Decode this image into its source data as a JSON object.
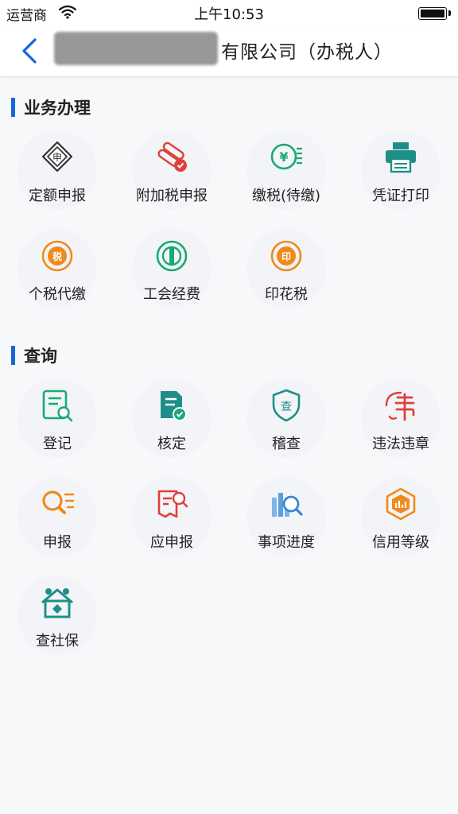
{
  "status": {
    "carrier": "运营商",
    "time": "上午10:53"
  },
  "nav": {
    "title": "有限公司（办税人）"
  },
  "sections": {
    "business": {
      "title": "业务办理",
      "items": [
        {
          "label": "定额申报",
          "icon": "declaration-icon"
        },
        {
          "label": "附加税申报",
          "icon": "surtax-icon"
        },
        {
          "label": "缴税(待缴)",
          "icon": "tax-payment-icon"
        },
        {
          "label": "凭证打印",
          "icon": "printer-icon"
        },
        {
          "label": "个税代缴",
          "icon": "personal-tax-icon"
        },
        {
          "label": "工会经费",
          "icon": "union-fee-icon"
        },
        {
          "label": "印花税",
          "icon": "stamp-tax-icon"
        }
      ]
    },
    "query": {
      "title": "查询",
      "items": [
        {
          "label": "登记",
          "icon": "registration-search-icon"
        },
        {
          "label": "核定",
          "icon": "verified-document-icon"
        },
        {
          "label": "稽查",
          "icon": "inspection-shield-icon"
        },
        {
          "label": "违法违章",
          "icon": "violation-icon"
        },
        {
          "label": "申报",
          "icon": "declaration-search-icon"
        },
        {
          "label": "应申报",
          "icon": "pending-declaration-icon"
        },
        {
          "label": "事项进度",
          "icon": "progress-chart-icon"
        },
        {
          "label": "信用等级",
          "icon": "credit-rating-icon"
        },
        {
          "label": "查社保",
          "icon": "social-security-icon"
        }
      ]
    }
  },
  "colors": {
    "accent": "#1565d8",
    "icon_red": "#e0403a",
    "icon_green": "#19a974",
    "icon_teal": "#1e8f88",
    "icon_orange": "#f08a1c"
  }
}
